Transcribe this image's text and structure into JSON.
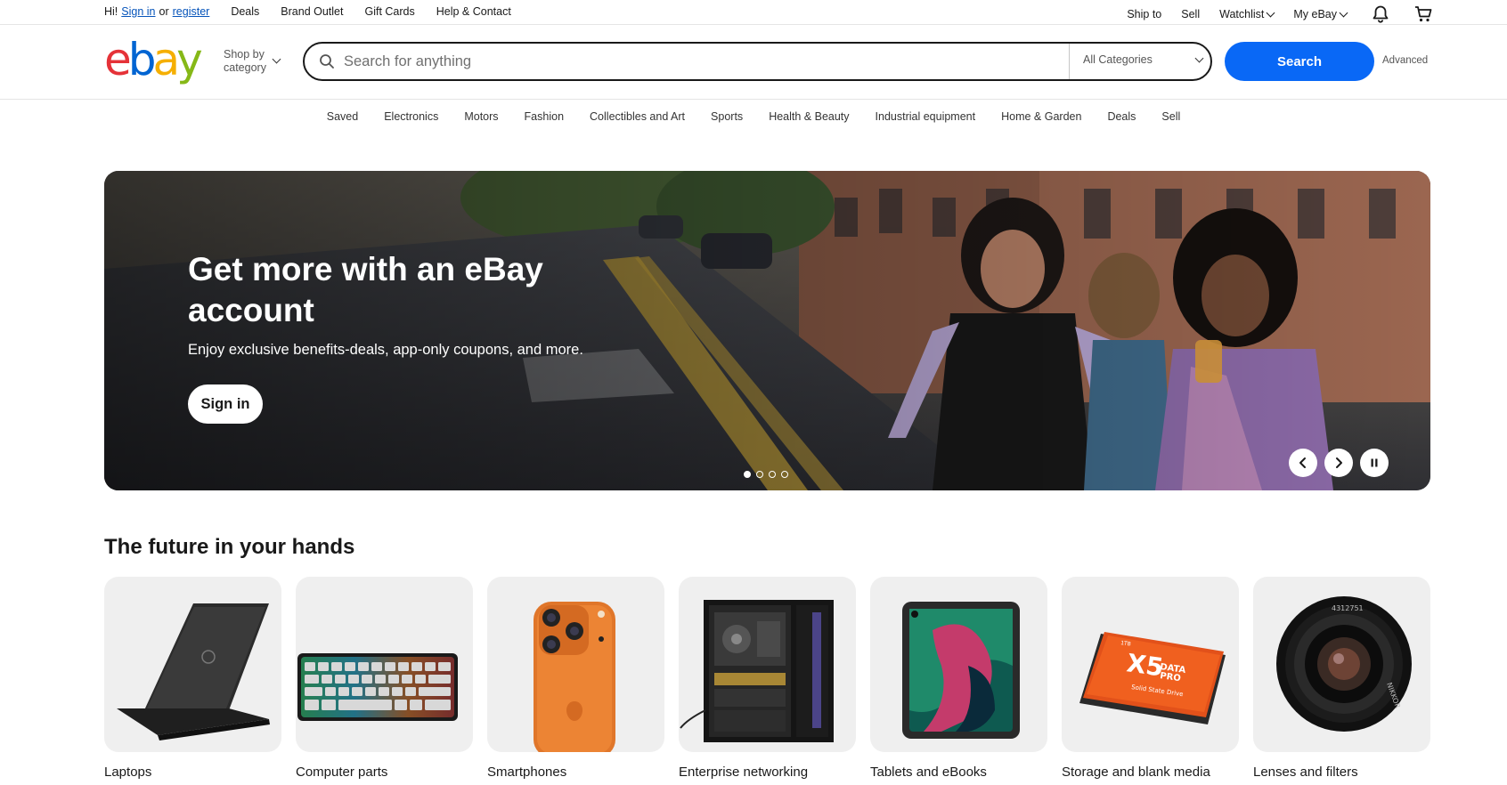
{
  "topbar": {
    "greeting": "Hi!",
    "sign_in": "Sign in",
    "or": "or",
    "register": "register",
    "links": [
      "Deals",
      "Brand Outlet",
      "Gift Cards",
      "Help & Contact"
    ],
    "ship_to": "Ship to",
    "sell": "Sell",
    "watchlist": "Watchlist",
    "my_ebay": "My eBay",
    "notification_icon": "bell-icon",
    "cart_icon": "cart-icon"
  },
  "header": {
    "logo_letters": [
      "e",
      "b",
      "a",
      "y"
    ],
    "logo_colors": [
      "#e53238",
      "#0064d2",
      "#f5af02",
      "#86b817"
    ],
    "shop_by_line1": "Shop by",
    "shop_by_line2": "category",
    "search_placeholder": "Search for anything",
    "search_value": "",
    "category_select": "All Categories",
    "search_button": "Search",
    "advanced": "Advanced",
    "accent_color": "#0968f6"
  },
  "nav": {
    "items": [
      "Saved",
      "Electronics",
      "Motors",
      "Fashion",
      "Collectibles and Art",
      "Sports",
      "Health & Beauty",
      "Industrial equipment",
      "Home & Garden",
      "Deals",
      "Sell"
    ]
  },
  "hero": {
    "title": "Get more with an eBay account",
    "subtitle": "Enjoy exclusive benefits-deals, app-only coupons, and more.",
    "button": "Sign in",
    "slide_count": 4,
    "active_slide": 1
  },
  "section": {
    "title": "The future in your hands",
    "cards": [
      {
        "label": "Laptops",
        "icon": "laptop-image"
      },
      {
        "label": "Computer parts",
        "icon": "keyboard-image"
      },
      {
        "label": "Smartphones",
        "icon": "smartphone-image"
      },
      {
        "label": "Enterprise networking",
        "icon": "server-case-image"
      },
      {
        "label": "Tablets and eBooks",
        "icon": "tablet-image"
      },
      {
        "label": "Storage and blank media",
        "icon": "ssd-image"
      },
      {
        "label": "Lenses and filters",
        "icon": "camera-lens-image"
      }
    ]
  }
}
